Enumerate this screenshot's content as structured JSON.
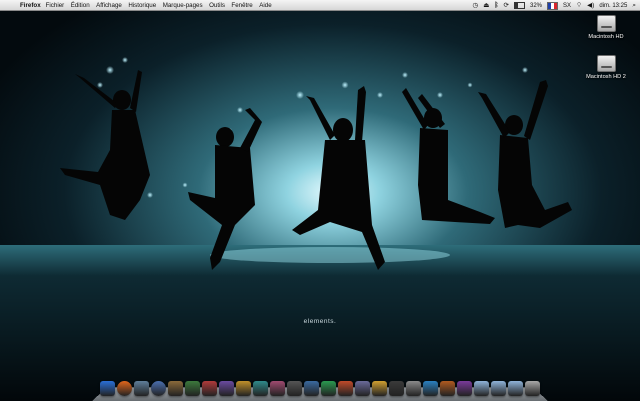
{
  "menubar": {
    "app_name": "Firefox",
    "menus": [
      "Fichier",
      "Édition",
      "Affichage",
      "Historique",
      "Marque-pages",
      "Outils",
      "Fenêtre",
      "Aide"
    ],
    "status": {
      "battery": "32%",
      "input_source": "SX",
      "clock": "dim. 13:25",
      "icons": [
        "time-machine-icon",
        "eject-icon",
        "bluetooth-icon",
        "sync-icon",
        "battery-icon",
        "flag-icon",
        "wifi-icon",
        "volume-icon",
        "spotlight-icon"
      ]
    }
  },
  "desktop": {
    "icons": [
      {
        "label": "Macintosh HD",
        "icon": "hard-drive-icon"
      },
      {
        "label": "Macintosh HD 2",
        "icon": "hard-drive-icon"
      }
    ],
    "wallpaper_caption": "elements."
  },
  "dock": {
    "items": [
      {
        "icon": "finder-icon",
        "color": "#2a6fd6"
      },
      {
        "icon": "firefox-icon",
        "color": "#e2661b"
      },
      {
        "icon": "preview-icon",
        "color": "#5f7e9a"
      },
      {
        "icon": "itunes-icon",
        "color": "#4a6fb0"
      },
      {
        "icon": "utility-icon",
        "color": "#8a6a3a"
      },
      {
        "icon": "app-icon",
        "color": "#3c7a3c"
      },
      {
        "icon": "app-icon",
        "color": "#b03a3a"
      },
      {
        "icon": "app-icon",
        "color": "#6a4aa0"
      },
      {
        "icon": "app-icon",
        "color": "#c0902a"
      },
      {
        "icon": "app-icon",
        "color": "#2f8a8a"
      },
      {
        "icon": "app-icon",
        "color": "#a04a70"
      },
      {
        "icon": "app-icon",
        "color": "#555555"
      },
      {
        "icon": "app-icon",
        "color": "#3a6aa0"
      },
      {
        "icon": "app-icon",
        "color": "#2a9a50"
      },
      {
        "icon": "app-icon",
        "color": "#c04a2a"
      },
      {
        "icon": "app-icon",
        "color": "#6a6a9a"
      },
      {
        "icon": "app-icon",
        "color": "#d0a030"
      },
      {
        "icon": "app-icon",
        "color": "#3a3a3a"
      },
      {
        "icon": "app-icon",
        "color": "#8a8a8a"
      },
      {
        "icon": "app-icon",
        "color": "#2a80c0"
      },
      {
        "icon": "app-icon",
        "color": "#b05a20"
      },
      {
        "icon": "app-icon",
        "color": "#7a3a9a"
      },
      {
        "icon": "folder-icon",
        "color": "#8fb3d9"
      },
      {
        "icon": "folder-icon",
        "color": "#8fb3d9"
      },
      {
        "icon": "folder-icon",
        "color": "#8fb3d9"
      },
      {
        "icon": "trash-icon",
        "color": "#a9a9a9"
      }
    ]
  }
}
